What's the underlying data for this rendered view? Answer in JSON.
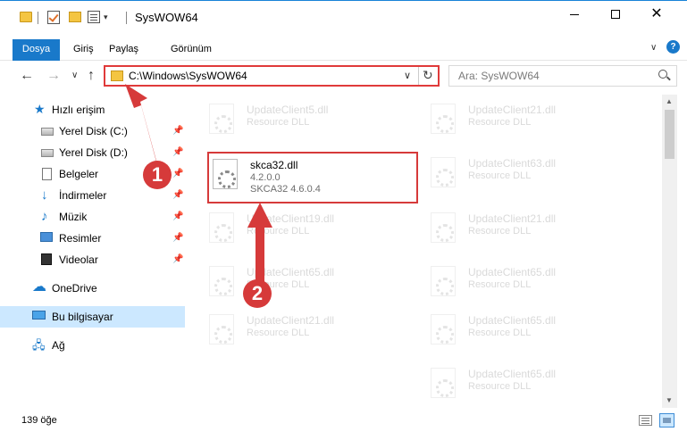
{
  "window": {
    "title": "SysWOW64"
  },
  "ribbon": {
    "tabs": [
      "Dosya",
      "Giriş",
      "Paylaş",
      "Görünüm"
    ],
    "accent_color": "#1979ca",
    "help_label": "?"
  },
  "nav": {
    "address": "C:\\Windows\\SysWOW64",
    "search_placeholder": "Ara: SysWOW64"
  },
  "sidebar": {
    "items": [
      {
        "label": "Hızlı erişim",
        "icon": "star-icon",
        "pinned": false
      },
      {
        "label": "Yerel Disk (C:)",
        "icon": "drive-icon",
        "pinned": true
      },
      {
        "label": "Yerel Disk (D:)",
        "icon": "drive-icon",
        "pinned": true
      },
      {
        "label": "Belgeler",
        "icon": "document-icon",
        "pinned": true
      },
      {
        "label": "İndirmeler",
        "icon": "download-icon",
        "pinned": true
      },
      {
        "label": "Müzik",
        "icon": "music-icon",
        "pinned": true
      },
      {
        "label": "Resimler",
        "icon": "pictures-icon",
        "pinned": true
      },
      {
        "label": "Videolar",
        "icon": "video-icon",
        "pinned": true
      },
      {
        "label": "OneDrive",
        "icon": "cloud-icon",
        "pinned": false
      },
      {
        "label": "Bu bilgisayar",
        "icon": "computer-icon",
        "pinned": false,
        "selected": true
      },
      {
        "label": "Ağ",
        "icon": "network-icon",
        "pinned": false
      }
    ]
  },
  "files": {
    "ghost_left": [
      {
        "name": "UpdateClient5.dll",
        "type": "Resource DLL"
      },
      {
        "name": "UpdateClient19.dll",
        "type": "Resource DLL"
      },
      {
        "name": "UpdateClient65.dll",
        "type": "Resource DLL"
      },
      {
        "name": "UpdateClient21.dll",
        "type": "Resource DLL"
      }
    ],
    "ghost_right": [
      {
        "name": "UpdateClient21.dll",
        "type": "Resource DLL"
      },
      {
        "name": "UpdateClient63.dll",
        "type": "Resource DLL"
      },
      {
        "name": "UpdateClient21.dll",
        "type": "Resource DLL"
      },
      {
        "name": "UpdateClient65.dll",
        "type": "Resource DLL"
      },
      {
        "name": "UpdateClient65.dll",
        "type": "Resource DLL"
      },
      {
        "name": "UpdateClient65.dll",
        "type": "Resource DLL"
      }
    ],
    "highlighted": {
      "name": "skca32.dll",
      "version": "4.2.0.0",
      "description": "SKCA32 4.6.0.4"
    }
  },
  "status": {
    "item_count": "139 öğe"
  },
  "annotations": {
    "step1": "1",
    "step2": "2",
    "color": "#d63a3a"
  }
}
